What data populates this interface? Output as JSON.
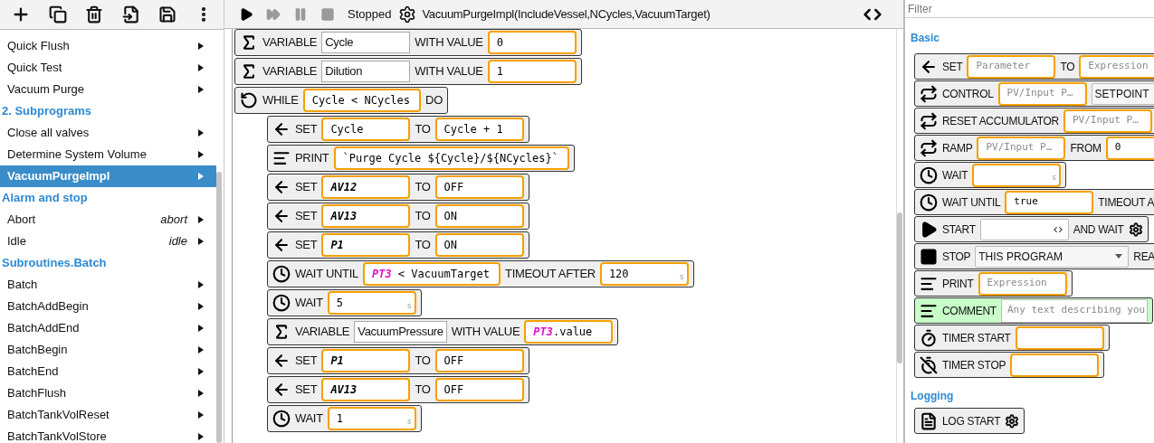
{
  "sidebar": {
    "items": [
      {
        "kind": "program",
        "label": "Quick Flush",
        "selected": false
      },
      {
        "kind": "program",
        "label": "Quick Test",
        "selected": false
      },
      {
        "kind": "program",
        "label": "Vacuum Purge",
        "selected": false
      },
      {
        "kind": "group",
        "label": "2. Subprograms"
      },
      {
        "kind": "program",
        "label": "Close all valves",
        "selected": false
      },
      {
        "kind": "program",
        "label": "Determine System Volume",
        "selected": false
      },
      {
        "kind": "program",
        "label": "VacuumPurgeImpl",
        "selected": true
      },
      {
        "kind": "group",
        "label": "Alarm and stop"
      },
      {
        "kind": "program",
        "label": "Abort",
        "alias": "abort",
        "selected": false
      },
      {
        "kind": "program",
        "label": "Idle",
        "alias": "idle",
        "selected": false
      },
      {
        "kind": "group",
        "label": "Subroutines.Batch"
      },
      {
        "kind": "program",
        "label": "Batch",
        "selected": false
      },
      {
        "kind": "program",
        "label": "BatchAddBegin",
        "selected": false
      },
      {
        "kind": "program",
        "label": "BatchAddEnd",
        "selected": false
      },
      {
        "kind": "program",
        "label": "BatchBegin",
        "selected": false
      },
      {
        "kind": "program",
        "label": "BatchEnd",
        "selected": false
      },
      {
        "kind": "program",
        "label": "BatchFlush",
        "selected": false
      },
      {
        "kind": "program",
        "label": "BatchTankVolReset",
        "selected": false
      },
      {
        "kind": "program",
        "label": "BatchTankVolStore",
        "selected": false
      }
    ]
  },
  "toolbar": {
    "controls": [
      {
        "kind": "run",
        "disabled": false
      },
      {
        "kind": "step",
        "disabled": true
      },
      {
        "kind": "pause",
        "disabled": true
      },
      {
        "kind": "stop",
        "disabled": true
      }
    ],
    "status": "Stopped",
    "signature": "VacuumPurgeImpl(IncludeVessel,NCycles,VacuumTarget)"
  },
  "program": {
    "blocks": [
      {
        "kind": "variable",
        "items": [
          {
            "kind": "label",
            "text": "VARIABLE"
          },
          {
            "kind": "name",
            "text": "Cycle"
          },
          {
            "kind": "label",
            "text": "WITH VALUE"
          },
          {
            "kind": "slot",
            "parts": [
              {
                "kind": "code",
                "text": "0"
              }
            ]
          }
        ]
      },
      {
        "kind": "variable",
        "items": [
          {
            "kind": "label",
            "text": "VARIABLE"
          },
          {
            "kind": "name",
            "text": "Dilution"
          },
          {
            "kind": "label",
            "text": "WITH VALUE"
          },
          {
            "kind": "slot",
            "parts": [
              {
                "kind": "code",
                "text": "1"
              }
            ]
          }
        ]
      },
      {
        "kind": "while",
        "items": [
          {
            "kind": "label",
            "text": "WHILE"
          },
          {
            "kind": "slot",
            "parts": [
              {
                "kind": "code",
                "text": "Cycle < NCycles"
              }
            ]
          },
          {
            "kind": "label",
            "text": "DO"
          }
        ],
        "children": [
          {
            "kind": "set",
            "items": [
              {
                "kind": "label",
                "text": "SET"
              },
              {
                "kind": "slot",
                "parts": [
                  {
                    "kind": "code",
                    "text": "Cycle"
                  }
                ]
              },
              {
                "kind": "label",
                "text": "TO"
              },
              {
                "kind": "slot",
                "parts": [
                  {
                    "kind": "code",
                    "text": "Cycle + 1"
                  }
                ]
              }
            ]
          },
          {
            "kind": "print",
            "items": [
              {
                "kind": "label",
                "text": "PRINT"
              },
              {
                "kind": "slot",
                "parts": [
                  {
                    "kind": "code",
                    "text": "`Purge Cycle ${Cycle}/${NCycles}`"
                  }
                ]
              }
            ]
          },
          {
            "kind": "set",
            "items": [
              {
                "kind": "label",
                "text": "SET"
              },
              {
                "kind": "slot",
                "parts": [
                  {
                    "kind": "output",
                    "text": "AV12"
                  }
                ]
              },
              {
                "kind": "label",
                "text": "TO"
              },
              {
                "kind": "slot",
                "parts": [
                  {
                    "kind": "code",
                    "text": "OFF"
                  }
                ]
              }
            ]
          },
          {
            "kind": "set",
            "items": [
              {
                "kind": "label",
                "text": "SET"
              },
              {
                "kind": "slot",
                "parts": [
                  {
                    "kind": "output",
                    "text": "AV13"
                  }
                ]
              },
              {
                "kind": "label",
                "text": "TO"
              },
              {
                "kind": "slot",
                "parts": [
                  {
                    "kind": "code",
                    "text": "ON"
                  }
                ]
              }
            ]
          },
          {
            "kind": "set",
            "items": [
              {
                "kind": "label",
                "text": "SET"
              },
              {
                "kind": "slot",
                "parts": [
                  {
                    "kind": "output",
                    "text": "P1"
                  }
                ]
              },
              {
                "kind": "label",
                "text": "TO"
              },
              {
                "kind": "slot",
                "parts": [
                  {
                    "kind": "code",
                    "text": "ON"
                  }
                ]
              }
            ]
          },
          {
            "kind": "wait_until",
            "items": [
              {
                "kind": "label",
                "text": "WAIT UNTIL"
              },
              {
                "kind": "slot",
                "parts": [
                  {
                    "kind": "input",
                    "text": "PT3"
                  },
                  {
                    "kind": "code",
                    "text": " < VacuumTarget"
                  }
                ]
              },
              {
                "kind": "label",
                "text": "TIMEOUT AFTER"
              },
              {
                "kind": "slot",
                "parts": [
                  {
                    "kind": "code",
                    "text": "120"
                  }
                ],
                "unit": "s"
              }
            ]
          },
          {
            "kind": "wait",
            "items": [
              {
                "kind": "label",
                "text": "WAIT"
              },
              {
                "kind": "slot",
                "parts": [
                  {
                    "kind": "code",
                    "text": "5"
                  }
                ],
                "unit": "s"
              }
            ]
          },
          {
            "kind": "variable",
            "items": [
              {
                "kind": "label",
                "text": "VARIABLE"
              },
              {
                "kind": "name",
                "text": "VacuumPressure"
              },
              {
                "kind": "label",
                "text": "WITH VALUE"
              },
              {
                "kind": "slot",
                "parts": [
                  {
                    "kind": "input",
                    "text": "PT3"
                  },
                  {
                    "kind": "code",
                    "text": ".value"
                  }
                ]
              }
            ]
          },
          {
            "kind": "set",
            "items": [
              {
                "kind": "label",
                "text": "SET"
              },
              {
                "kind": "slot",
                "parts": [
                  {
                    "kind": "output",
                    "text": "P1"
                  }
                ]
              },
              {
                "kind": "label",
                "text": "TO"
              },
              {
                "kind": "slot",
                "parts": [
                  {
                    "kind": "code",
                    "text": "OFF"
                  }
                ]
              }
            ]
          },
          {
            "kind": "set",
            "items": [
              {
                "kind": "label",
                "text": "SET"
              },
              {
                "kind": "slot",
                "parts": [
                  {
                    "kind": "output",
                    "text": "AV13"
                  }
                ]
              },
              {
                "kind": "label",
                "text": "TO"
              },
              {
                "kind": "slot",
                "parts": [
                  {
                    "kind": "code",
                    "text": "OFF"
                  }
                ]
              }
            ]
          },
          {
            "kind": "wait",
            "items": [
              {
                "kind": "label",
                "text": "WAIT"
              },
              {
                "kind": "slot",
                "parts": [
                  {
                    "kind": "code",
                    "text": "1"
                  }
                ],
                "unit": "s"
              }
            ]
          }
        ]
      }
    ]
  },
  "palette": {
    "filter": {
      "placeholder": "Filter"
    },
    "sections": [
      {
        "title": "Basic",
        "blocks": [
          {
            "kind": "set",
            "items": [
              {
                "kind": "label",
                "text": "SET"
              },
              {
                "kind": "slot",
                "placeholder": "Parameter"
              },
              {
                "kind": "label",
                "text": "TO"
              },
              {
                "kind": "slot",
                "placeholder": "Expression"
              }
            ]
          },
          {
            "kind": "control",
            "items": [
              {
                "kind": "label",
                "text": "CONTROL"
              },
              {
                "kind": "slot",
                "placeholder": "PV/Input P…"
              },
              {
                "kind": "select",
                "text": "SETPOINT"
              }
            ]
          },
          {
            "kind": "reset",
            "items": [
              {
                "kind": "label",
                "text": "RESET ACCUMULATOR"
              },
              {
                "kind": "slot",
                "placeholder": "PV/Input P…"
              }
            ]
          },
          {
            "kind": "ramp",
            "items": [
              {
                "kind": "label",
                "text": "RAMP"
              },
              {
                "kind": "slot",
                "placeholder": "PV/Input P…"
              },
              {
                "kind": "label",
                "text": "FROM"
              },
              {
                "kind": "slot",
                "parts": [
                  {
                    "kind": "code",
                    "text": "0"
                  }
                ]
              }
            ]
          },
          {
            "kind": "wait",
            "items": [
              {
                "kind": "label",
                "text": "WAIT"
              },
              {
                "kind": "slot",
                "unit": "s"
              }
            ]
          },
          {
            "kind": "wait_until",
            "items": [
              {
                "kind": "label",
                "text": "WAIT UNTIL"
              },
              {
                "kind": "slot",
                "parts": [
                  {
                    "kind": "code",
                    "text": "true"
                  }
                ]
              },
              {
                "kind": "label",
                "text": "TIMEOUT A"
              }
            ]
          },
          {
            "kind": "start",
            "items": [
              {
                "kind": "label",
                "text": "START"
              },
              {
                "kind": "program"
              },
              {
                "kind": "label",
                "text": "AND WAIT"
              },
              {
                "kind": "settings"
              }
            ]
          },
          {
            "kind": "stop",
            "items": [
              {
                "kind": "label",
                "text": "STOP"
              },
              {
                "kind": "dropdown",
                "text": "THIS PROGRAM"
              },
              {
                "kind": "label",
                "text": "REA"
              }
            ]
          },
          {
            "kind": "print",
            "items": [
              {
                "kind": "label",
                "text": "PRINT"
              },
              {
                "kind": "slot",
                "placeholder": "Expression"
              }
            ]
          },
          {
            "kind": "comment",
            "items": [
              {
                "kind": "label",
                "text": "COMMENT"
              },
              {
                "kind": "comment",
                "placeholder": "Any text describing you"
              }
            ]
          },
          {
            "kind": "timer_start",
            "items": [
              {
                "kind": "label",
                "text": "TIMER START"
              },
              {
                "kind": "slot"
              }
            ]
          },
          {
            "kind": "timer_stop",
            "items": [
              {
                "kind": "label",
                "text": "TIMER STOP"
              },
              {
                "kind": "slot"
              }
            ]
          }
        ]
      },
      {
        "title": "Logging",
        "blocks": [
          {
            "kind": "log_start",
            "items": [
              {
                "kind": "label",
                "text": "LOG START"
              },
              {
                "kind": "settings"
              }
            ]
          }
        ]
      }
    ]
  }
}
